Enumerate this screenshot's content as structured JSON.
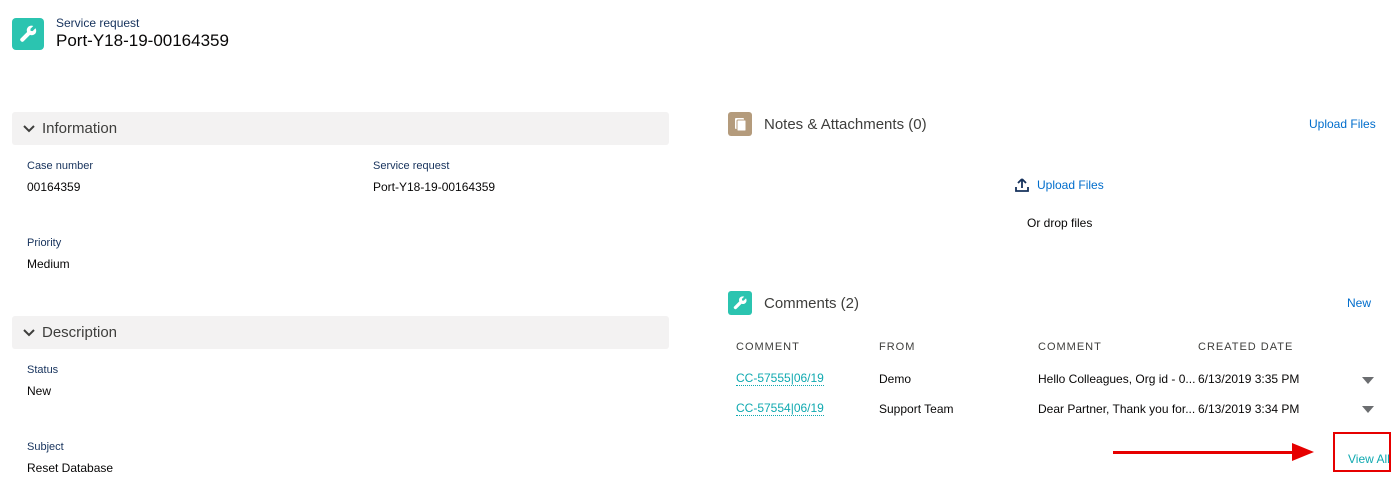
{
  "header": {
    "subtitle": "Service request",
    "title": "Port-Y18-19-00164359",
    "icon": "wrench-icon",
    "icon_color": "#2bc4b0"
  },
  "information": {
    "section_title": "Information",
    "case_number_label": "Case number",
    "case_number_value": "00164359",
    "service_request_label": "Service request",
    "service_request_value": "Port-Y18-19-00164359",
    "priority_label": "Priority",
    "priority_value": "Medium"
  },
  "description": {
    "section_title": "Description",
    "status_label": "Status",
    "status_value": "New",
    "subject_label": "Subject",
    "subject_value": "Reset Database"
  },
  "notes": {
    "title": "Notes & Attachments (0)",
    "icon": "file-icon",
    "icon_color": "#b49b7c",
    "upload_files_header": "Upload Files",
    "upload_files_button": "Upload Files",
    "drop_text": "Or drop files"
  },
  "comments": {
    "title": "Comments (2)",
    "icon": "wrench-icon",
    "icon_color": "#2bc4b0",
    "new_label": "New",
    "columns": [
      "COMMENT",
      "FROM",
      "COMMENT",
      "CREATED DATE"
    ],
    "rows": [
      {
        "id": "CC-57555|06/19",
        "from": "Demo",
        "comment": "Hello Colleagues, Org id - 0...",
        "created": "6/13/2019 3:35 PM"
      },
      {
        "id": "CC-57554|06/19",
        "from": "Support Team",
        "comment": "Dear Partner, Thank you for...",
        "created": "6/13/2019 3:34 PM"
      }
    ],
    "view_all": "View All"
  },
  "colors": {
    "highlight": "#e60000",
    "link": "#006dcc",
    "teal_link": "#0fa9b0"
  }
}
